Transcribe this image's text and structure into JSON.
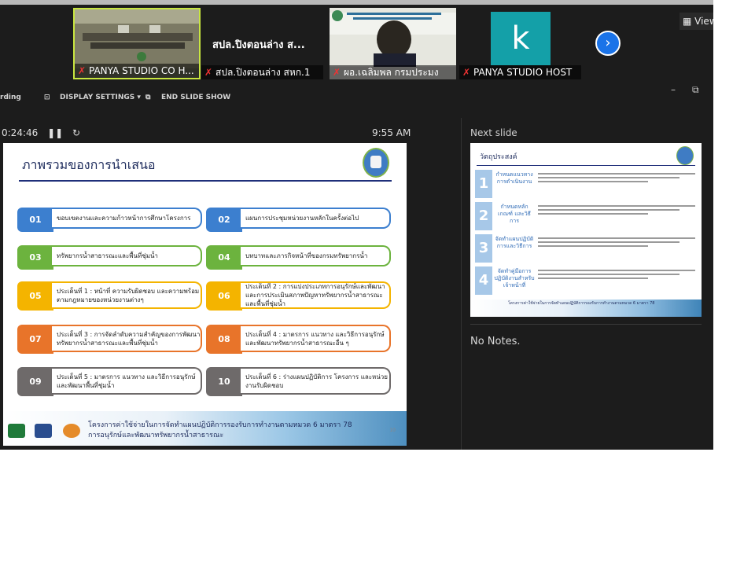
{
  "participants": [
    {
      "name": "PANYA STUDIO CO H...",
      "muted": true
    },
    {
      "name": "สปล.ปิงตอนล่าง สหก.1",
      "display_title": "สปล.ปิงตอนล่าง ส...",
      "muted": true
    },
    {
      "name": "ผอ.เฉลิมพล กรมประมง",
      "muted": true
    },
    {
      "name": "PANYA STUDIO HOST",
      "avatar_letter": "k",
      "muted": true
    }
  ],
  "view_button": "View",
  "toolbar": {
    "recording": "rding",
    "display_settings": "DISPLAY SETTINGS ▾",
    "end_slide_show": "END SLIDE SHOW"
  },
  "presenter": {
    "elapsed": "0:24:46",
    "clock": "9:55 AM",
    "next_slide_label": "Next slide",
    "notes": "No Notes."
  },
  "slide": {
    "title": "ภาพรวมของการนำเสนอ",
    "items": [
      {
        "num": "01",
        "text": "ขอบเขตงานและความก้าวหน้าการศึกษาโครงการ",
        "color": "#3c7fcf"
      },
      {
        "num": "02",
        "text": "แผนการประชุมหน่วยงานหลักในครั้งต่อไป",
        "color": "#3c7fcf"
      },
      {
        "num": "03",
        "text": "ทรัพยากรน้ำสาธารณะและพื้นที่ชุ่มน้ำ",
        "color": "#6cb33e"
      },
      {
        "num": "04",
        "text": "บทบาทและภารกิจหน้าที่ของกรมทรัพยากรน้ำ",
        "color": "#6cb33e"
      },
      {
        "num": "05",
        "text": "ประเด็นที่ 1 : หน้าที่ ความรับผิดชอบ และความพร้อมตามกฎหมายของหน่วยงานต่างๆ",
        "color": "#f4b400"
      },
      {
        "num": "06",
        "text": "ประเด็นที่ 2 : การแบ่งประเภทการอนุรักษ์และพัฒนาและการประเมินสภาพปัญหาทรัพยากรน้ำสาธารณะและพื้นที่ชุ่มน้ำ",
        "color": "#f4b400"
      },
      {
        "num": "07",
        "text": "ประเด็นที่ 3 : การจัดลำดับความสำคัญของการพัฒนาทรัพยากรน้ำสาธารณะและพื้นที่ชุ่มน้ำ",
        "color": "#e8742a"
      },
      {
        "num": "08",
        "text": "ประเด็นที่ 4 : มาตรการ แนวทาง และวิธีการอนุรักษ์ และพัฒนาทรัพยากรน้ำสาธารณะอื่น ๆ",
        "color": "#e8742a"
      },
      {
        "num": "09",
        "text": "ประเด็นที่ 5 : มาตรการ แนวทาง และวิธีการอนุรักษ์ และพัฒนาพื้นที่ชุ่มน้ำ",
        "color": "#6e6a6a"
      },
      {
        "num": "10",
        "text": "ประเด็นที่ 6 : ร่างแผนปฏิบัติการ โครงการ และหน่วยงานรับผิดชอบ",
        "color": "#6e6a6a"
      }
    ],
    "footer_line1": "โครงการค่าใช้จ่ายในการจัดทำแผนปฏิบัติการรองรับการทำงานตามหมวด 6 มาตรา 78",
    "footer_line2": "การอนุรักษ์และพัฒนาทรัพยากรน้ำสาธารณะ",
    "page_number": "10"
  },
  "next_slide": {
    "title": "วัตถุประสงค์",
    "rows": [
      {
        "num": "1",
        "head": "กำหนดแนวทางการดำเนินงาน"
      },
      {
        "num": "2",
        "head": "กำหนดหลักเกณฑ์ และวิธีการ"
      },
      {
        "num": "3",
        "head": "จัดทำแผนปฏิบัติการและวิธีการ"
      },
      {
        "num": "4",
        "head": "จัดทำคู่มือการปฏิบัติงานสำหรับเจ้าหน้าที่"
      }
    ],
    "footer": "โครงการค่าใช้จ่ายในการจัดทำแผนปฏิบัติการรองรับการทำงานตามหมวด 6 มาตรา 78"
  }
}
